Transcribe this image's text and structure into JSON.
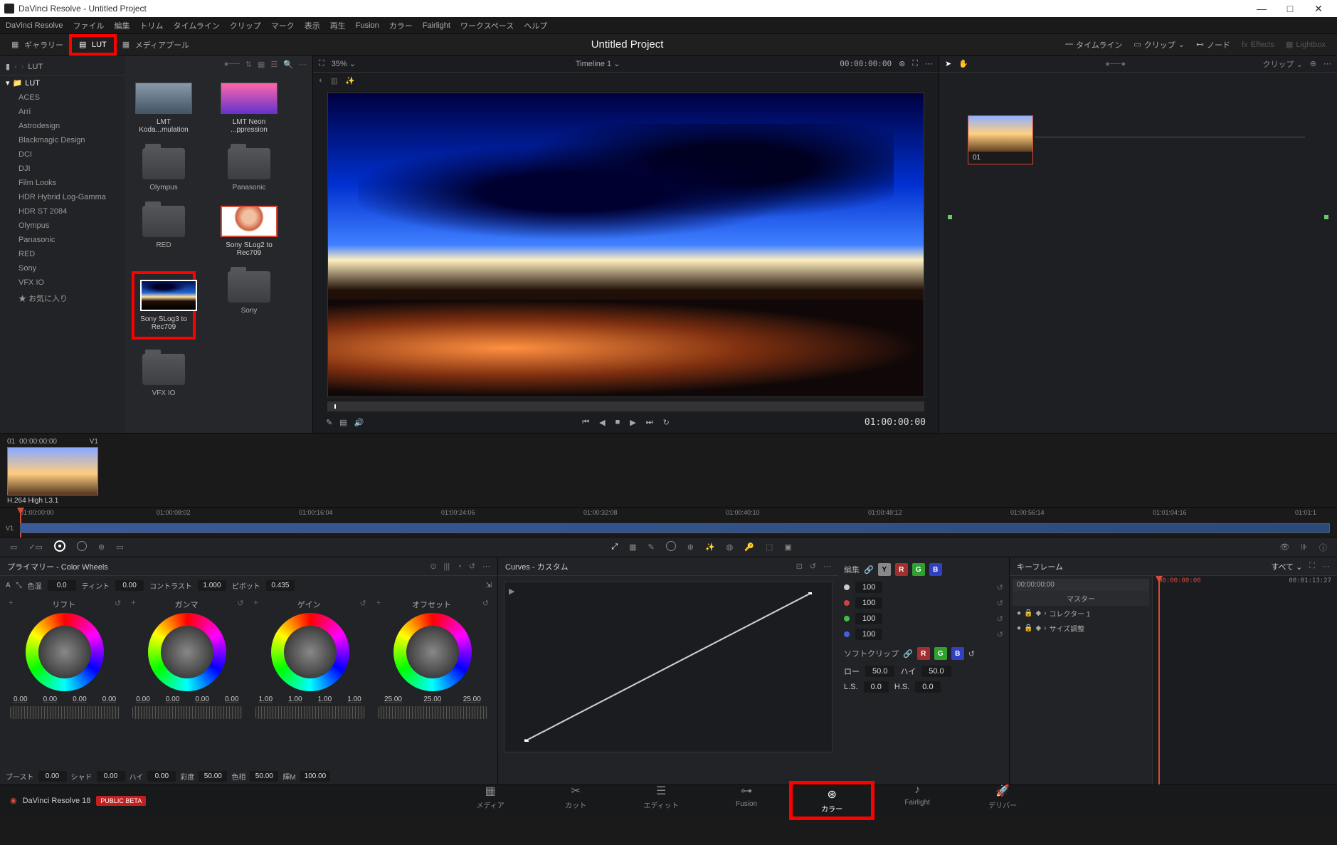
{
  "window": {
    "title": "DaVinci Resolve - Untitled Project"
  },
  "menu": [
    "DaVinci Resolve",
    "ファイル",
    "編集",
    "トリム",
    "タイムライン",
    "クリップ",
    "マーク",
    "表示",
    "再生",
    "Fusion",
    "カラー",
    "Fairlight",
    "ワークスペース",
    "ヘルプ"
  ],
  "topbar": {
    "gallery": "ギャラリー",
    "lut": "LUT",
    "mediapool": "メディアプール",
    "project": "Untitled Project",
    "right": {
      "timeline": "タイムライン",
      "clip": "クリップ",
      "node": "ノード",
      "effects": "Effects",
      "lightbox": "Lightbox"
    }
  },
  "lut_tree": {
    "title": "LUT",
    "root": "LUT",
    "items": [
      "ACES",
      "Arri",
      "Astrodesign",
      "Blackmagic Design",
      "DCI",
      "DJI",
      "Film Looks",
      "HDR Hybrid Log-Gamma",
      "HDR ST 2084",
      "Olympus",
      "Panasonic",
      "RED",
      "Sony",
      "VFX IO"
    ],
    "fav": "お気に入り"
  },
  "lut_grid": {
    "items": [
      {
        "kind": "thumb",
        "label": "LMT Koda...mulation"
      },
      {
        "kind": "thumb",
        "label": "LMT Neon ...ppression"
      },
      {
        "kind": "folder",
        "label": "Olympus"
      },
      {
        "kind": "folder",
        "label": "Panasonic"
      },
      {
        "kind": "folder",
        "label": "RED"
      },
      {
        "kind": "thumb",
        "label": "Sony SLog2 to Rec709",
        "selected": true,
        "portrait": true
      },
      {
        "kind": "thumb",
        "label": "Sony SLog3 to Rec709",
        "highlight": true,
        "sky": true
      },
      {
        "kind": "folder",
        "label": "Sony"
      },
      {
        "kind": "folder",
        "label": "VFX IO"
      }
    ]
  },
  "viewer": {
    "zoom": "35%",
    "timeline_name": "Timeline 1",
    "tc": "00:00:00:00",
    "out_tc": "01:00:00:00"
  },
  "nodes": {
    "clip": "クリップ",
    "node_label": "01"
  },
  "clip_thumb": {
    "hdr_num": "01",
    "hdr_tc": "00:00:00:00",
    "hdr_track": "V1",
    "label": "H.264 High L3.1"
  },
  "timeline_ruler": [
    "01:00:00:00",
    "01:00:08:02",
    "01:00:16:04",
    "01:00:24:06",
    "01:00:32:08",
    "01:00:40:10",
    "01:00:48:12",
    "01:00:56:14",
    "01:01:04:16",
    "01:01:1"
  ],
  "tl_track": "V1",
  "primary": {
    "title": "プライマリー - Color Wheels",
    "temp": {
      "label": "色温",
      "val": "0.0"
    },
    "tint": {
      "label": "ティント",
      "val": "0.00"
    },
    "contrast": {
      "label": "コントラスト",
      "val": "1.000"
    },
    "pivot": {
      "label": "ピボット",
      "val": "0.435"
    },
    "wheels": [
      {
        "name": "リフト",
        "vals": [
          "0.00",
          "0.00",
          "0.00",
          "0.00"
        ]
      },
      {
        "name": "ガンマ",
        "vals": [
          "0.00",
          "0.00",
          "0.00",
          "0.00"
        ]
      },
      {
        "name": "ゲイン",
        "vals": [
          "1.00",
          "1.00",
          "1.00",
          "1.00"
        ]
      },
      {
        "name": "オフセット",
        "vals": [
          "25.00",
          "25.00",
          "25.00"
        ]
      }
    ],
    "adjust": {
      "boost": "ブースト",
      "boost_v": "0.00",
      "shad": "シャド",
      "shad_v": "0.00",
      "hi": "ハイ",
      "hi_v": "0.00",
      "sat": "彩度",
      "sat_v": "50.00",
      "hue": "色相",
      "hue_v": "50.00",
      "lum": "輝M",
      "lum_v": "100.00"
    }
  },
  "curves": {
    "title": "Curves - カスタム",
    "edit": "編集",
    "vals": [
      "100",
      "100",
      "100",
      "100"
    ],
    "softclip": "ソフトクリップ",
    "low": "ロー",
    "low_v": "50.0",
    "high": "ハイ",
    "high_v": "50.0",
    "ls": "L.S.",
    "ls_v": "0.0",
    "hs": "H.S.",
    "hs_v": "0.0"
  },
  "keyframe": {
    "title": "キーフレーム",
    "filter": "すべて",
    "tc_start": "00:00:00:00",
    "tc_cur": "00:00:00:00",
    "tc_end": "00:01:13:27",
    "master": "マスター",
    "rows": [
      "コレクター 1",
      "サイズ調整"
    ]
  },
  "pages": {
    "brand": "DaVinci Resolve 18",
    "beta": "PUBLIC BETA",
    "items": [
      {
        "label": "メディア"
      },
      {
        "label": "カット"
      },
      {
        "label": "エディット"
      },
      {
        "label": "Fusion"
      },
      {
        "label": "カラー",
        "active": true
      },
      {
        "label": "Fairlight"
      },
      {
        "label": "デリバー"
      }
    ]
  }
}
